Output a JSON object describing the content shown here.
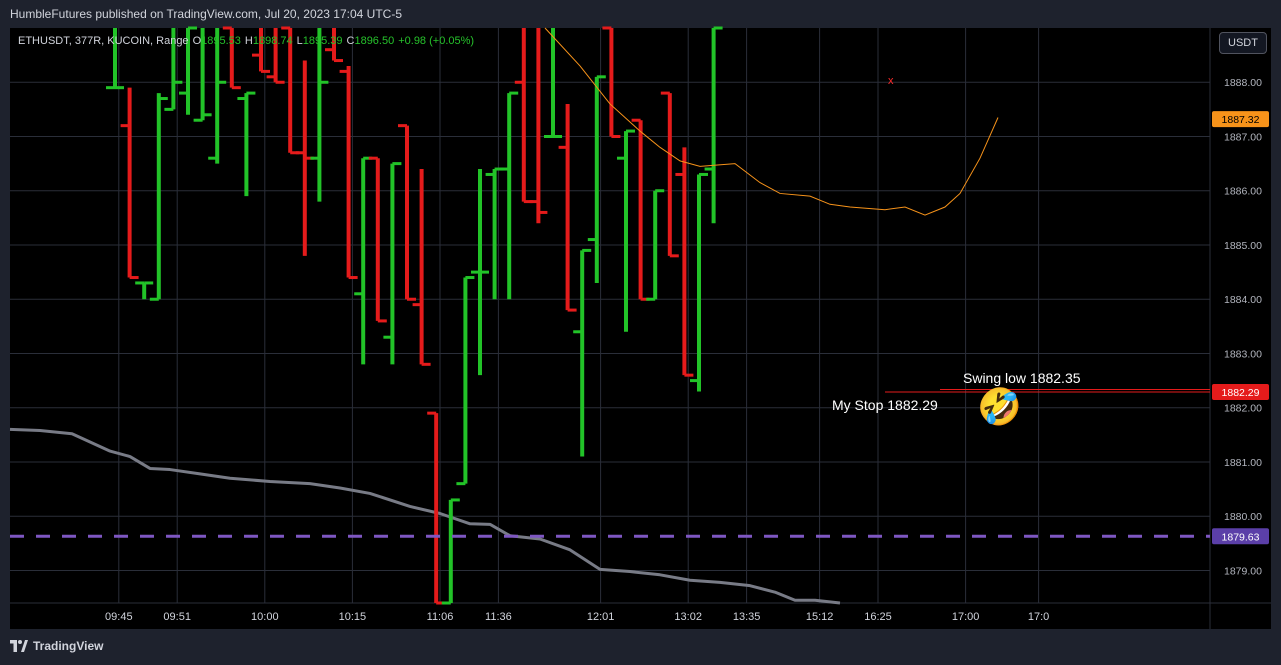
{
  "header": {
    "published_text": "HumbleFutures published on TradingView.com, Jul 20, 2023 17:04 UTC-5"
  },
  "legend": {
    "symbol": "ETHUSDT, 377R, KUCOIN, Range",
    "open_label": "O",
    "open_value": "1895.53",
    "high_label": "H",
    "high_value": "1898.74",
    "low_label": "L",
    "low_value": "1895.39",
    "close_label": "C",
    "close_value": "1896.50",
    "change": "+0.98 (+0.05%)"
  },
  "toolbar": {
    "currency_label": "USDT"
  },
  "footer": {
    "brand": "TradingView"
  },
  "annotations": {
    "swing_low": "Swing low 1882.35",
    "my_stop": "My Stop 1882.29",
    "emoji": "🤣",
    "marker": "x"
  },
  "colors": {
    "background": "#000000",
    "frame": "#1e222d",
    "grid": "#2a2e39",
    "up": "#22c328",
    "down": "#e51b1b",
    "ma_line": "#f7931a",
    "gray_line": "#787b86",
    "purple_line": "#7e57c2",
    "stop_line": "#e51b1b",
    "badge_orange": "#f7931a",
    "badge_red": "#e51b1b",
    "badge_purple": "#5b3fa8"
  },
  "chart_data": {
    "type": "ohlc",
    "y_ticks": [
      1888.0,
      1887.0,
      1886.0,
      1885.0,
      1884.0,
      1883.0,
      1882.0,
      1881.0,
      1880.0,
      1879.0
    ],
    "ylim": [
      1878.4,
      1889.0
    ],
    "x_ticks": [
      {
        "label": "09:45",
        "i": 3
      },
      {
        "label": "09:51",
        "i": 7
      },
      {
        "label": "10:00",
        "i": 13
      },
      {
        "label": "10:15",
        "i": 19
      },
      {
        "label": "11:06",
        "i": 25
      },
      {
        "label": "11:36",
        "i": 29
      },
      {
        "label": "12:01",
        "i": 36
      },
      {
        "label": "13:02",
        "i": 42
      },
      {
        "label": "13:35",
        "i": 46
      },
      {
        "label": "15:12",
        "i": 51
      },
      {
        "label": "16:25",
        "i": 55
      },
      {
        "label": "17:00",
        "i": 61
      },
      {
        "label": "17:0",
        "i": 66
      }
    ],
    "bars": [
      {
        "o": 1887.9,
        "h": 1890.0,
        "l": 1887.9,
        "c": 1887.9
      },
      {
        "o": 1887.2,
        "h": 1887.9,
        "l": 1884.4,
        "c": 1884.4
      },
      {
        "o": 1884.3,
        "h": 1884.3,
        "l": 1884.0,
        "c": 1884.3
      },
      {
        "o": 1884.0,
        "h": 1887.8,
        "l": 1884.0,
        "c": 1887.7
      },
      {
        "o": 1887.5,
        "h": 1890.0,
        "l": 1887.5,
        "c": 1888.0
      },
      {
        "o": 1887.8,
        "h": 1890.0,
        "l": 1887.4,
        "c": 1890.0
      },
      {
        "o": 1887.3,
        "h": 1889.0,
        "l": 1887.3,
        "c": 1887.4
      },
      {
        "o": 1886.6,
        "h": 1890.0,
        "l": 1886.5,
        "c": 1888.0
      },
      {
        "o": 1890.0,
        "h": 1890.0,
        "l": 1887.9,
        "c": 1887.9
      },
      {
        "o": 1887.7,
        "h": 1887.8,
        "l": 1885.9,
        "c": 1887.8
      },
      {
        "o": 1888.5,
        "h": 1890.0,
        "l": 1888.2,
        "c": 1888.2
      },
      {
        "o": 1888.1,
        "h": 1890.0,
        "l": 1888.0,
        "c": 1888.0
      },
      {
        "o": 1890.0,
        "h": 1890.0,
        "l": 1886.7,
        "c": 1886.7
      },
      {
        "o": 1886.7,
        "h": 1888.4,
        "l": 1884.8,
        "c": 1886.6
      },
      {
        "o": 1886.6,
        "h": 1890.0,
        "l": 1885.8,
        "c": 1888.0
      },
      {
        "o": 1888.6,
        "h": 1890.0,
        "l": 1888.4,
        "c": 1888.4
      },
      {
        "o": 1888.2,
        "h": 1888.3,
        "l": 1884.4,
        "c": 1884.4
      },
      {
        "o": 1884.1,
        "h": 1886.6,
        "l": 1882.8,
        "c": 1886.6
      },
      {
        "o": 1886.6,
        "h": 1886.6,
        "l": 1883.6,
        "c": 1883.6
      },
      {
        "o": 1883.3,
        "h": 1886.5,
        "l": 1882.8,
        "c": 1886.5
      },
      {
        "o": 1887.2,
        "h": 1887.2,
        "l": 1884.0,
        "c": 1884.0
      },
      {
        "o": 1883.9,
        "h": 1886.4,
        "l": 1882.8,
        "c": 1882.8
      },
      {
        "o": 1881.9,
        "h": 1881.9,
        "l": 1878.0,
        "c": 1878.0
      },
      {
        "o": 1878.0,
        "h": 1880.3,
        "l": 1878.0,
        "c": 1880.3
      },
      {
        "o": 1880.6,
        "h": 1884.4,
        "l": 1880.6,
        "c": 1884.4
      },
      {
        "o": 1884.5,
        "h": 1886.4,
        "l": 1882.6,
        "c": 1884.5
      },
      {
        "o": 1886.3,
        "h": 1886.4,
        "l": 1884.0,
        "c": 1886.4
      },
      {
        "o": 1886.4,
        "h": 1887.8,
        "l": 1884.0,
        "c": 1887.8
      },
      {
        "o": 1888.0,
        "h": 1890.0,
        "l": 1885.8,
        "c": 1885.8
      },
      {
        "o": 1885.8,
        "h": 1890.0,
        "l": 1885.4,
        "c": 1885.6
      },
      {
        "o": 1887.0,
        "h": 1890.0,
        "l": 1887.0,
        "c": 1887.0
      },
      {
        "o": 1886.8,
        "h": 1887.6,
        "l": 1883.8,
        "c": 1883.8
      },
      {
        "o": 1883.4,
        "h": 1884.9,
        "l": 1881.1,
        "c": 1884.9
      },
      {
        "o": 1885.1,
        "h": 1888.1,
        "l": 1884.3,
        "c": 1888.1
      },
      {
        "o": 1890.0,
        "h": 1890.0,
        "l": 1887.0,
        "c": 1887.0
      },
      {
        "o": 1886.6,
        "h": 1887.1,
        "l": 1883.4,
        "c": 1887.1
      },
      {
        "o": 1887.3,
        "h": 1887.3,
        "l": 1884.0,
        "c": 1884.0
      },
      {
        "o": 1884.0,
        "h": 1886.0,
        "l": 1884.0,
        "c": 1886.0
      },
      {
        "o": 1887.8,
        "h": 1887.8,
        "l": 1884.8,
        "c": 1884.8
      },
      {
        "o": 1886.3,
        "h": 1886.8,
        "l": 1882.6,
        "c": 1882.6
      },
      {
        "o": 1882.5,
        "h": 1886.3,
        "l": 1882.3,
        "c": 1886.3
      },
      {
        "o": 1886.4,
        "h": 1890.0,
        "l": 1885.4,
        "c": 1890.0
      }
    ],
    "ma_line": [
      {
        "x": 545,
        "y": 1889.0
      },
      {
        "x": 580,
        "y": 1888.3
      },
      {
        "x": 610,
        "y": 1887.6
      },
      {
        "x": 640,
        "y": 1887.1
      },
      {
        "x": 660,
        "y": 1886.8
      },
      {
        "x": 680,
        "y": 1886.55
      },
      {
        "x": 700,
        "y": 1886.45
      },
      {
        "x": 735,
        "y": 1886.5
      },
      {
        "x": 760,
        "y": 1886.15
      },
      {
        "x": 780,
        "y": 1885.95
      },
      {
        "x": 810,
        "y": 1885.9
      },
      {
        "x": 830,
        "y": 1885.75
      },
      {
        "x": 850,
        "y": 1885.7
      },
      {
        "x": 885,
        "y": 1885.65
      },
      {
        "x": 905,
        "y": 1885.7
      },
      {
        "x": 925,
        "y": 1885.55
      },
      {
        "x": 945,
        "y": 1885.7
      },
      {
        "x": 960,
        "y": 1885.95
      },
      {
        "x": 980,
        "y": 1886.6
      },
      {
        "x": 998,
        "y": 1887.35
      }
    ],
    "gray_line": [
      {
        "x": 10,
        "y": 1881.6
      },
      {
        "x": 40,
        "y": 1881.58
      },
      {
        "x": 72,
        "y": 1881.52
      },
      {
        "x": 110,
        "y": 1881.2
      },
      {
        "x": 130,
        "y": 1881.1
      },
      {
        "x": 150,
        "y": 1880.88
      },
      {
        "x": 170,
        "y": 1880.86
      },
      {
        "x": 200,
        "y": 1880.78
      },
      {
        "x": 230,
        "y": 1880.7
      },
      {
        "x": 270,
        "y": 1880.64
      },
      {
        "x": 310,
        "y": 1880.6
      },
      {
        "x": 340,
        "y": 1880.52
      },
      {
        "x": 370,
        "y": 1880.42
      },
      {
        "x": 410,
        "y": 1880.18
      },
      {
        "x": 440,
        "y": 1880.05
      },
      {
        "x": 470,
        "y": 1879.86
      },
      {
        "x": 490,
        "y": 1879.85
      },
      {
        "x": 510,
        "y": 1879.64
      },
      {
        "x": 540,
        "y": 1879.58
      },
      {
        "x": 570,
        "y": 1879.38
      },
      {
        "x": 600,
        "y": 1879.02
      },
      {
        "x": 630,
        "y": 1878.98
      },
      {
        "x": 660,
        "y": 1878.92
      },
      {
        "x": 690,
        "y": 1878.82
      },
      {
        "x": 720,
        "y": 1878.78
      },
      {
        "x": 750,
        "y": 1878.72
      },
      {
        "x": 775,
        "y": 1878.6
      },
      {
        "x": 795,
        "y": 1878.45
      },
      {
        "x": 815,
        "y": 1878.45
      },
      {
        "x": 840,
        "y": 1878.2
      }
    ],
    "level_lines": [
      {
        "value": 1882.29,
        "label": "1882.29",
        "style": "solid",
        "badge": "red"
      },
      {
        "value": 1879.63,
        "label": "1879.63",
        "style": "dashed",
        "badge": "purple"
      }
    ],
    "price_badges": [
      {
        "value": 1887.32,
        "label": "1887.32",
        "badge": "orange"
      }
    ]
  }
}
